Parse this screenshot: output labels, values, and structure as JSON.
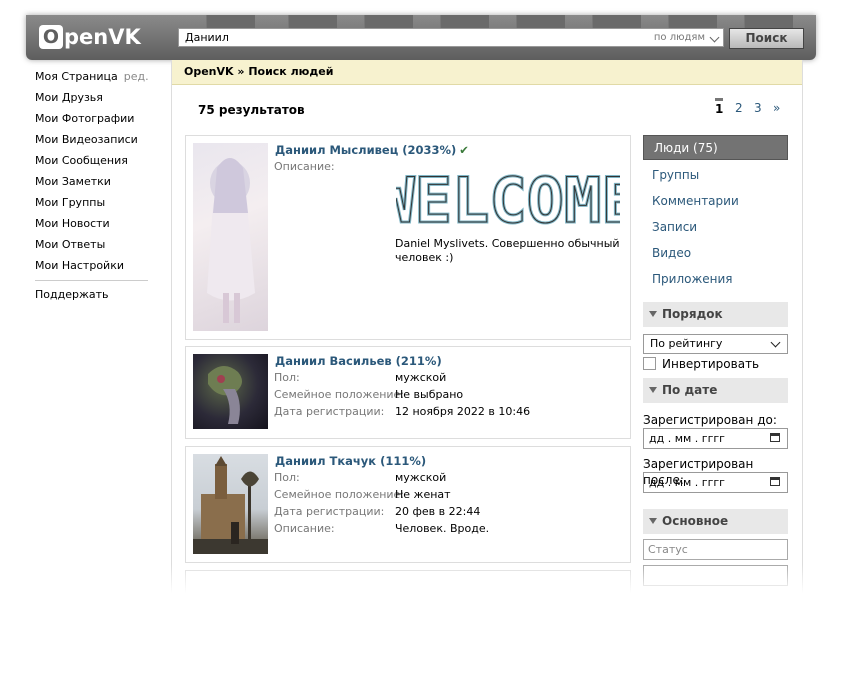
{
  "header": {
    "logo_text": "penVK",
    "logo_letter": "O",
    "search_value": "Даниил",
    "search_scope": "по людям",
    "search_button": "Поиск"
  },
  "menu": {
    "items": [
      "Моя Страница",
      "Мои Друзья",
      "Мои Фотографии",
      "Мои Видеозаписи",
      "Мои Сообщения",
      "Мои Заметки",
      "Мои Группы",
      "Мои Новости",
      "Мои Ответы",
      "Мои Настройки"
    ],
    "edit_label": "ред.",
    "support": "Поддержать"
  },
  "breadcrumb": "OpenVK » Поиск людей",
  "results_count": "75 результатов",
  "pager": [
    "1",
    "2",
    "3",
    "»"
  ],
  "cards": [
    {
      "name": "Даниил Мысливец (2033%)",
      "verified": "✔",
      "desc_label": "Описание:",
      "welcome_text": "WELCOME",
      "description": "Daniel Myslivets. Совершенно обычный человек :)"
    },
    {
      "name": "Даниил Васильев (211%)",
      "fields": [
        {
          "label": "Пол:",
          "value": "мужской"
        },
        {
          "label": "Семейное положение:",
          "value": "Не выбрано"
        },
        {
          "label": "Дата регистрации:",
          "value": "12 ноября 2022 в 10:46"
        }
      ]
    },
    {
      "name": "Даниил Ткачук (111%)",
      "fields": [
        {
          "label": "Пол:",
          "value": "мужской"
        },
        {
          "label": "Семейное положение:",
          "value": "Не женат"
        },
        {
          "label": "Дата регистрации:",
          "value": "20 фев в 22:44"
        },
        {
          "label": "Описание:",
          "value": "Человек. Вроде."
        }
      ]
    }
  ],
  "right": {
    "tabs": [
      "Люди (75)",
      "Группы",
      "Комментарии",
      "Записи",
      "Видео",
      "Приложения"
    ],
    "order_head": "Порядок",
    "order_value": "По рейтингу",
    "invert": "Инвертировать",
    "date_head": "По дате",
    "reg_before": "Зарегистрирован до:",
    "reg_after": "Зарегистрирован после:",
    "date_placeholder": "дд . мм . гггг",
    "main_head": "Основное",
    "status_placeholder": "Статус"
  },
  "colors": {
    "link": "#2b587a",
    "header": "#5e5e5e",
    "breadcrumb_bg": "#f7f2cf"
  }
}
